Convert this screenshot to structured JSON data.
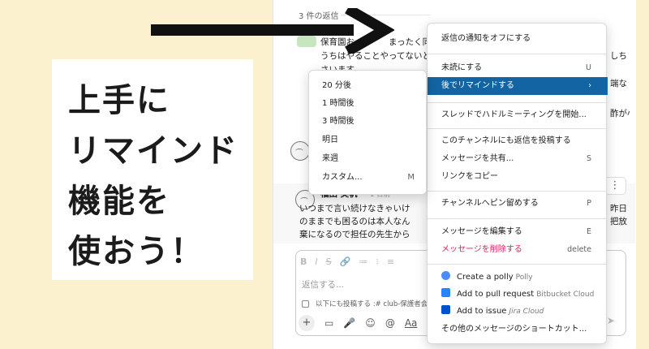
{
  "thread": {
    "reply_count": "3 件の返信",
    "msg1_lines": [
      "保育園お　　　　まったく同じ",
      "うちはやることやってないと",
      "さいます。"
    ],
    "right_edge_fragments": [
      "しち",
      "端な",
      "酢が小"
    ],
    "msg3_name": "福田 美帆",
    "msg3_time": "1 日前",
    "msg3_lines": [
      "いつまで言い続けなきゃいけ",
      "のままでも困るのは本人なん",
      "棄になるので担任の先生から"
    ],
    "msg3_right_fragments": [
      "昨日",
      "把放"
    ],
    "more_icon": "more-vertical-icon"
  },
  "composer": {
    "format_icons": [
      "B",
      "I",
      "S",
      "🔗",
      "≔",
      "⁝",
      "≡"
    ],
    "placeholder": "返信する...",
    "also_post_label": "以下にも投稿する :# club-保護者会",
    "tools": [
      "+",
      "▭",
      "🎤",
      "☺",
      "@",
      "Aa"
    ],
    "send_icon": "send-icon"
  },
  "callout": {
    "lines": [
      "上手に",
      "リマインド",
      "機能を",
      "使おう！"
    ]
  },
  "menu": {
    "items": [
      {
        "label": "返信の通知をオフにする",
        "shortcut": ""
      },
      {
        "label": "未読にする",
        "shortcut": "U"
      },
      {
        "label": "後でリマインドする",
        "shortcut": "›"
      },
      {
        "label": "スレッドでハドルミーティングを開始...",
        "shortcut": ""
      },
      {
        "label": "このチャンネルにも返信を投稿する",
        "shortcut": ""
      },
      {
        "label": "メッセージを共有...",
        "shortcut": "S"
      },
      {
        "label": "リンクをコピー",
        "shortcut": ""
      },
      {
        "label": "チャンネルへピン留めする",
        "shortcut": "P"
      },
      {
        "label": "メッセージを編集する",
        "shortcut": "E"
      },
      {
        "label": "メッセージを削除する",
        "shortcut": "delete"
      },
      {
        "label": "Create a polly",
        "sub": "Polly"
      },
      {
        "label": "Add to pull request",
        "sub": "Bitbucket Cloud"
      },
      {
        "label": "Add to issue",
        "sub": "Jira Cloud"
      },
      {
        "label": "その他のメッセージのショートカット...",
        "shortcut": ""
      }
    ]
  },
  "submenu": {
    "items": [
      {
        "label": "20 分後",
        "shortcut": ""
      },
      {
        "label": "1 時間後",
        "shortcut": ""
      },
      {
        "label": "3 時間後",
        "shortcut": ""
      },
      {
        "label": "明日",
        "shortcut": ""
      },
      {
        "label": "来週",
        "shortcut": ""
      },
      {
        "label": "カスタム...",
        "shortcut": "M"
      }
    ]
  },
  "colors": {
    "background": "#fbf1cf",
    "menu_active": "#1264a3",
    "danger": "#e01e5a",
    "arrow": "#111111"
  }
}
